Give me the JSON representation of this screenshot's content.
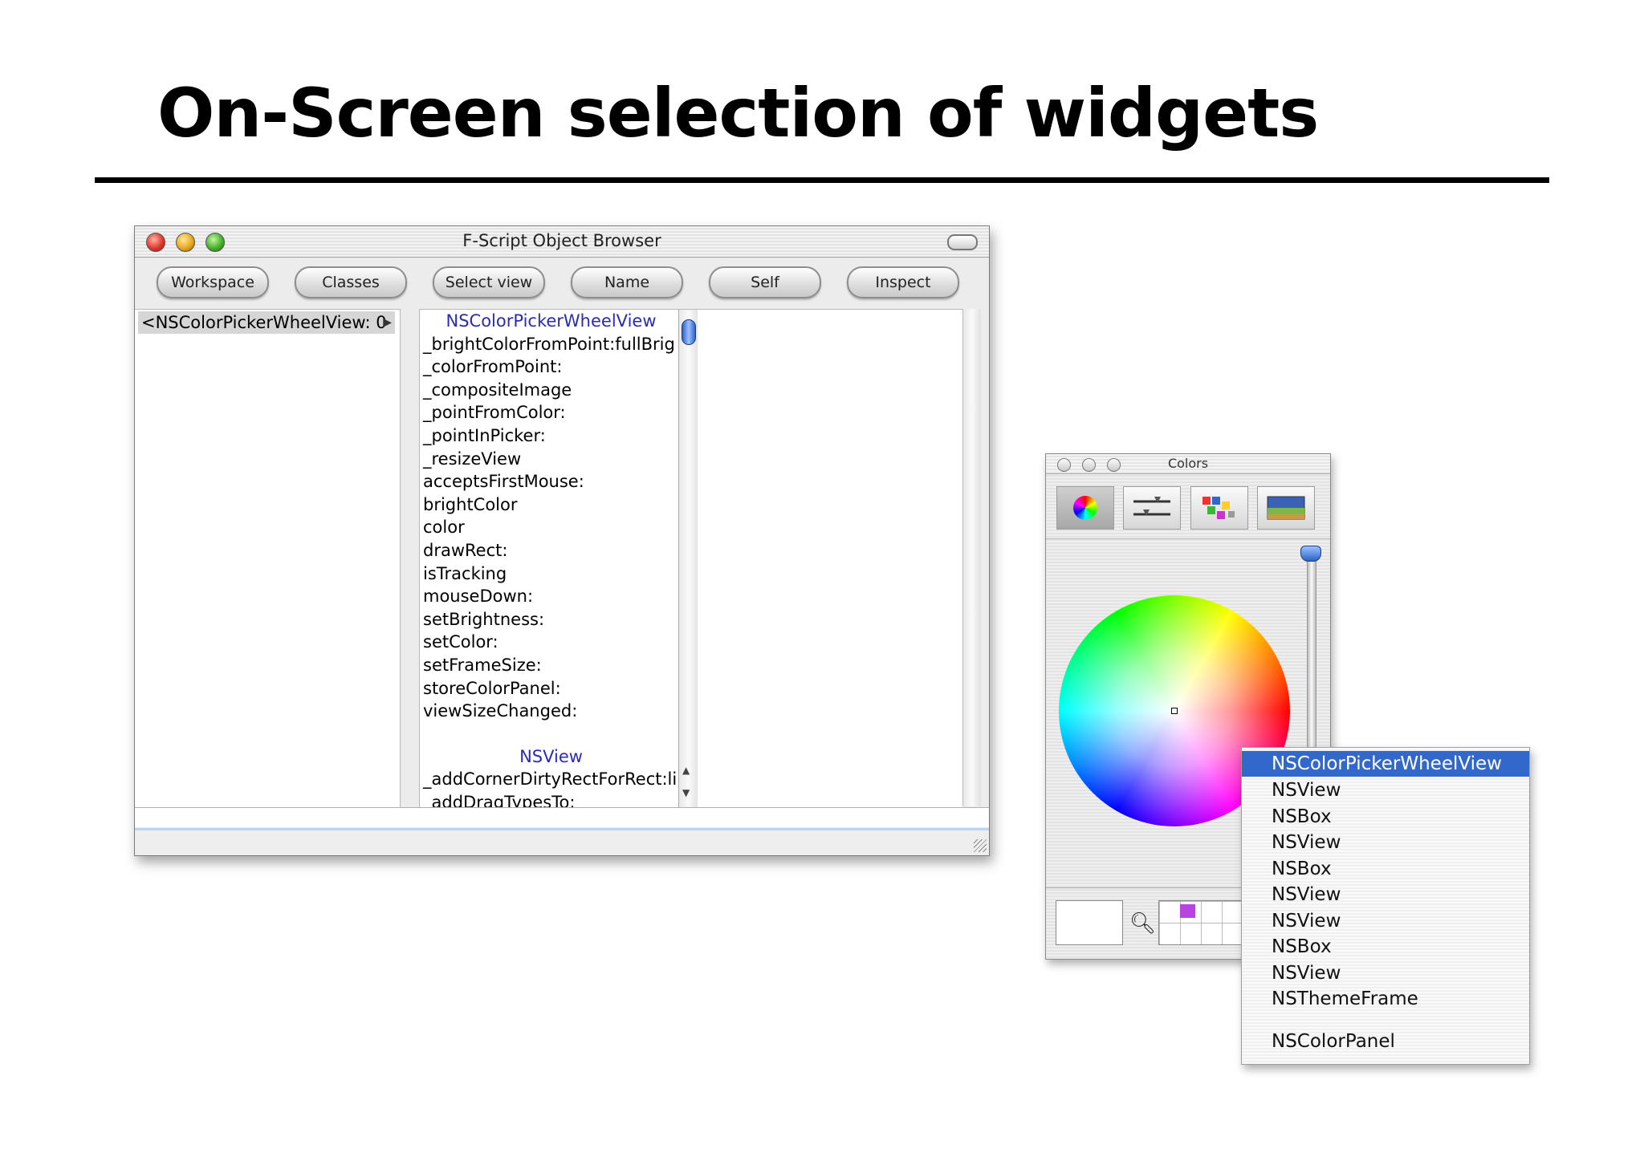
{
  "slide": {
    "title": "On-Screen selection of widgets"
  },
  "object_browser": {
    "title": "F-Script Object Browser",
    "buttons": [
      "Workspace",
      "Classes",
      "Select view",
      "Name",
      "Self",
      "Inspect"
    ],
    "column1_item": "<NSColorPickerWheelView: 0",
    "class1": "NSColorPickerWheelView",
    "methods": [
      "_brightColorFromPoint:fullBrig",
      "_colorFromPoint:",
      "_compositeImage",
      "_pointFromColor:",
      "_pointInPicker:",
      "_resizeView",
      "acceptsFirstMouse:",
      "brightColor",
      "color",
      "drawRect:",
      "isTracking",
      "mouseDown:",
      "setBrightness:",
      "setColor:",
      "setFrameSize:",
      "storeColorPanel:",
      "viewSizeChanged:"
    ],
    "class2": "NSView",
    "class2_methods": [
      "_addCornerDirtyRectForRect:li",
      "_addDragTypesTo:"
    ]
  },
  "colors_panel": {
    "title": "Colors",
    "tools": [
      "color-wheel-icon",
      "sliders-icon",
      "palettes-icon",
      "image-palette-icon"
    ],
    "selected_swatch_color": "#b743e0"
  },
  "popup_menu": {
    "selected": "NSColorPickerWheelView",
    "items": [
      "NSView",
      "NSBox",
      "NSView",
      "NSBox",
      "NSView",
      "NSView",
      "NSBox",
      "NSView",
      "NSThemeFrame"
    ],
    "last": "NSColorPanel"
  }
}
